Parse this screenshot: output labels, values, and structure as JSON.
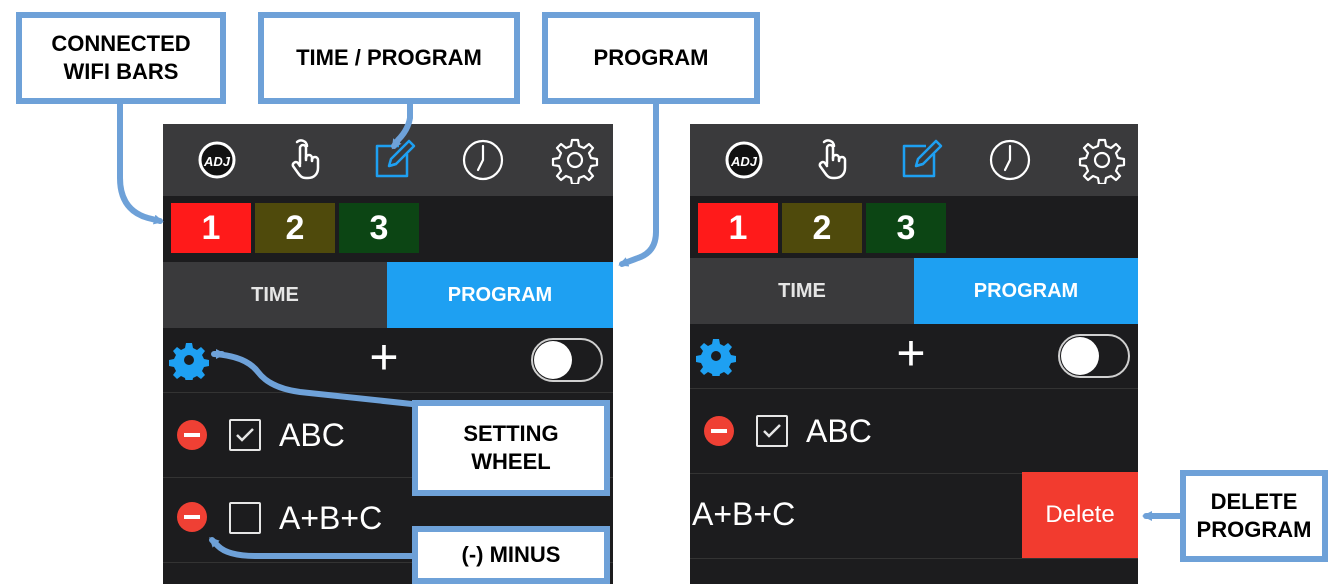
{
  "callouts": {
    "connected_wifi_bars": {
      "line1": "CONNECTED",
      "line2": "WIFI BARS"
    },
    "time_program": "TIME / PROGRAM",
    "program": "PROGRAM",
    "setting_wheel": {
      "line1": "SETTING",
      "line2": "WHEEL"
    },
    "minus": "(-) MINUS",
    "delete_program": {
      "line1": "DELETE",
      "line2": "PROGRAM"
    }
  },
  "nav_icons": [
    "adj-logo-icon",
    "touch-hand-icon",
    "edit-pencil-icon",
    "clock-icon",
    "settings-gear-icon"
  ],
  "adj_logo_text": "ADJ",
  "wifi_bars": [
    {
      "label": "1",
      "color": "#ff1a1a"
    },
    {
      "label": "2",
      "color": "#4f4a0c"
    },
    {
      "label": "3",
      "color": "#0c4514"
    }
  ],
  "tabs": {
    "time": "TIME",
    "program": "PROGRAM",
    "active": "program"
  },
  "colors": {
    "accent": "#1ea0f2",
    "delete": "#f23b2f",
    "minus": "#ef4034",
    "callout_border": "#6ea1d8"
  },
  "toolbar": {
    "settings_icon": "settings-gear-icon",
    "add_icon": "plus-icon",
    "add_label": "+",
    "toggle_on": false
  },
  "programs_left": [
    {
      "label": "ABC",
      "checked": true
    },
    {
      "label": "A+B+C",
      "checked": false
    }
  ],
  "programs_right": {
    "row1": {
      "label": "ABC",
      "checked": true
    },
    "row2": {
      "label": "A+B+C",
      "delete_label": "Delete"
    }
  }
}
